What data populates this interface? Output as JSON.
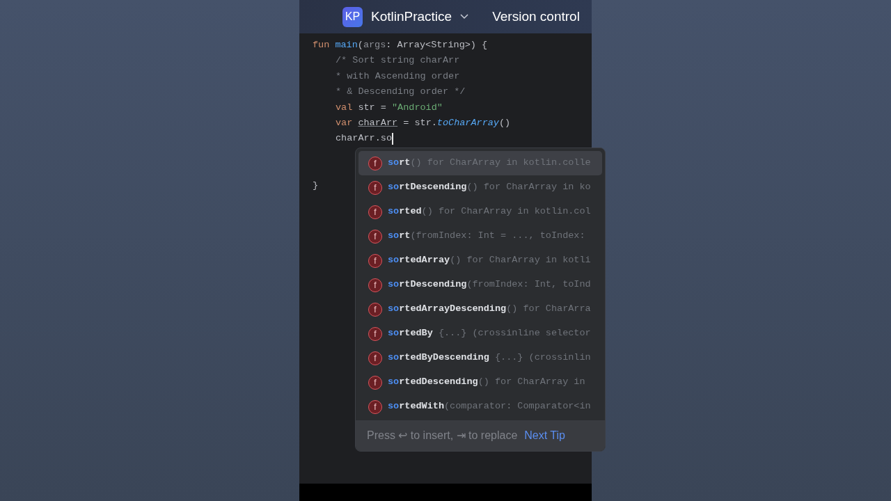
{
  "header": {
    "project_badge": "KP",
    "project_name": "KotlinPractice",
    "version_control": "Version control"
  },
  "code_lines": [
    {
      "indented": false,
      "cursor": false,
      "tokens": [
        {
          "kind": "keyword",
          "text": "fun "
        },
        {
          "kind": "function",
          "text": "main"
        },
        {
          "kind": "plain",
          "text": "("
        },
        {
          "kind": "param",
          "text": "args"
        },
        {
          "kind": "plain",
          "text": ": Array<String>) {"
        }
      ]
    },
    {
      "indented": true,
      "cursor": false,
      "tokens": [
        {
          "kind": "comment",
          "text": "/* Sort string charArr"
        }
      ]
    },
    {
      "indented": true,
      "cursor": false,
      "tokens": [
        {
          "kind": "comment",
          "text": "* with Ascending order"
        }
      ]
    },
    {
      "indented": true,
      "cursor": false,
      "tokens": [
        {
          "kind": "comment",
          "text": "* & Descending order */"
        }
      ]
    },
    {
      "indented": true,
      "cursor": false,
      "tokens": [
        {
          "kind": "keyword",
          "text": "val "
        },
        {
          "kind": "plain",
          "text": "str = "
        },
        {
          "kind": "string",
          "text": "\"Android\""
        }
      ]
    },
    {
      "indented": true,
      "cursor": false,
      "tokens": [
        {
          "kind": "keyword",
          "text": "var "
        },
        {
          "kind": "variable",
          "text": "charArr"
        },
        {
          "kind": "plain",
          "text": " = str."
        },
        {
          "kind": "call",
          "text": "toCharArray"
        },
        {
          "kind": "plain",
          "text": "()"
        }
      ]
    },
    {
      "indented": true,
      "cursor": true,
      "tokens": [
        {
          "kind": "plain",
          "text": "charArr.so"
        }
      ]
    }
  ],
  "closing_brace": "}",
  "completion": {
    "items": [
      {
        "icon": "f",
        "match": "so",
        "rest": "rt",
        "detail": "() for CharArray in kotlin.colle",
        "selected": true
      },
      {
        "icon": "f",
        "match": "so",
        "rest": "rtDescending",
        "detail": "() for CharArray in ko",
        "selected": false
      },
      {
        "icon": "f",
        "match": "so",
        "rest": "rted",
        "detail": "() for CharArray in kotlin.col",
        "selected": false
      },
      {
        "icon": "f",
        "match": "so",
        "rest": "rt",
        "detail": "(fromIndex: Int = ..., toIndex:",
        "selected": false
      },
      {
        "icon": "f",
        "match": "so",
        "rest": "rtedArray",
        "detail": "() for CharArray in kotli",
        "selected": false
      },
      {
        "icon": "f",
        "match": "so",
        "rest": "rtDescending",
        "detail": "(fromIndex: Int, toInd",
        "selected": false
      },
      {
        "icon": "f",
        "match": "so",
        "rest": "rtedArrayDescending",
        "detail": "() for CharArra",
        "selected": false
      },
      {
        "icon": "f",
        "match": "so",
        "rest": "rtedBy",
        "detail": " {...} (crossinline selector",
        "selected": false
      },
      {
        "icon": "f",
        "match": "so",
        "rest": "rtedByDescending",
        "detail": " {...} (crossinlin",
        "selected": false
      },
      {
        "icon": "f",
        "match": "so",
        "rest": "rtedDescending",
        "detail": "() for CharArray in",
        "selected": false
      },
      {
        "icon": "f",
        "match": "so",
        "rest": "rtedWith",
        "detail": "(comparator: Comparator<in",
        "selected": false
      }
    ],
    "hint": "Press ↩ to insert, ⇥ to replace",
    "next_tip": "Next Tip"
  }
}
